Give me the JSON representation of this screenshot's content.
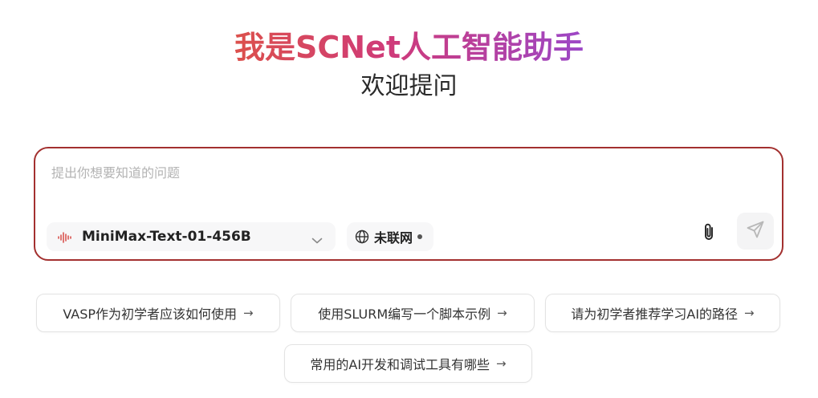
{
  "hero": {
    "title": "我是SCNet人工智能助手",
    "subtitle": "欢迎提问"
  },
  "composer": {
    "placeholder": "提出你想要知道的问题",
    "model": {
      "label": "MiniMax-Text-01-456B",
      "icon": "waveform-icon",
      "icon_color": "#d9534f"
    },
    "network": {
      "label": "未联网",
      "icon": "globe-icon"
    },
    "attach_icon": "paperclip-icon",
    "send_icon": "send-icon",
    "border_color": "#a3302f"
  },
  "suggestions": [
    {
      "label": "VASP作为初学者应该如何使用",
      "arrow": "→"
    },
    {
      "label": "使用SLURM编写一个脚本示例",
      "arrow": "→"
    },
    {
      "label": "请为初学者推荐学习AI的路径",
      "arrow": "→"
    },
    {
      "label": "常用的AI开发和调试工具有哪些",
      "arrow": "→"
    }
  ]
}
